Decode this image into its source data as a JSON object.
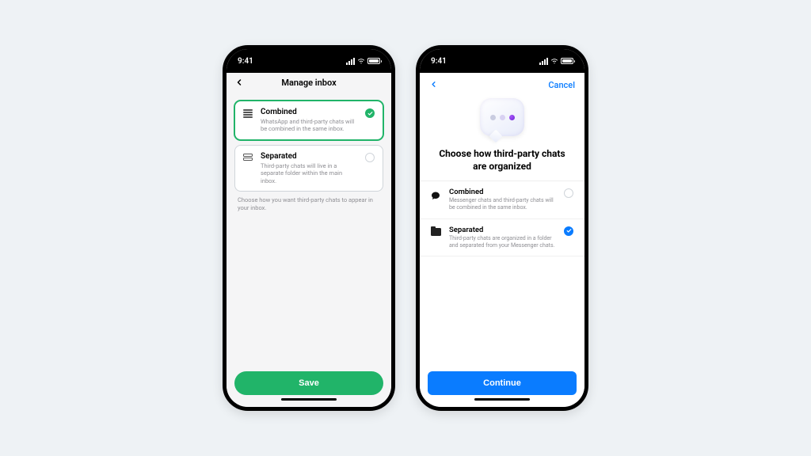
{
  "status": {
    "time": "9:41"
  },
  "whatsapp": {
    "title": "Manage inbox",
    "options": [
      {
        "title": "Combined",
        "subtitle": "WhatsApp and third-party chats will be combined in the same inbox.",
        "selected": true
      },
      {
        "title": "Separated",
        "subtitle": "Third-party chats will live in a separate folder within the main inbox.",
        "selected": false
      }
    ],
    "help": "Choose how you want third-party chats to appear in your inbox.",
    "save": "Save"
  },
  "messenger": {
    "cancel": "Cancel",
    "heading": "Choose how third-party chats are organized",
    "options": [
      {
        "title": "Combined",
        "subtitle": "Messenger chats and third-party chats will be combined in the same inbox.",
        "selected": false
      },
      {
        "title": "Separated",
        "subtitle": "Third-party chats are organized in a folder and separated from your Messenger chats.",
        "selected": true
      }
    ],
    "continue": "Continue"
  }
}
